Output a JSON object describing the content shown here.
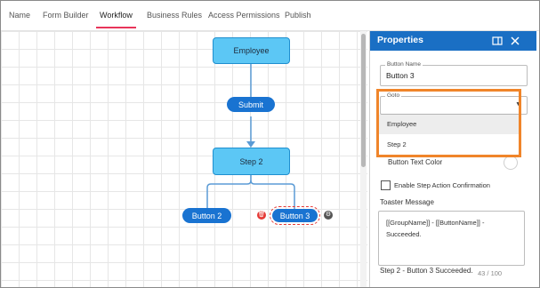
{
  "tabs": [
    {
      "label": "Name"
    },
    {
      "label": "Form Builder"
    },
    {
      "label": "Workflow"
    },
    {
      "label": "Business Rules"
    },
    {
      "label": "Access Permissions"
    },
    {
      "label": "Publish"
    }
  ],
  "active_tab": "Workflow",
  "workflow": {
    "nodes": {
      "employee": "Employee",
      "submit": "Submit",
      "step2": "Step 2",
      "button2": "Button 2",
      "button3": "Button 3"
    },
    "colors": {
      "node_fill": "#5cc7f5",
      "button_fill": "#1973d1",
      "connector": "#5b9bd5",
      "selection": "#e53935"
    }
  },
  "properties": {
    "title": "Properties",
    "button_name_label": "Button Name",
    "button_name_value": "Button 3",
    "goto_label": "Goto",
    "goto_value": "",
    "goto_options": [
      "Employee",
      "Step 2"
    ],
    "button_text_color_label": "Button Text Color",
    "enable_confirmation_label": "Enable Step Action Confirmation",
    "enable_confirmation_checked": false,
    "toaster_label": "Toaster Message",
    "toaster_value": "[[GroupName]] - [[ButtonName]] - Succeeded.",
    "toaster_preview": "Step 2 - Button 3 Succeeded.",
    "char_count": "43 / 100",
    "highlight_color": "#f0852a",
    "header_color": "#1a6fc4"
  }
}
